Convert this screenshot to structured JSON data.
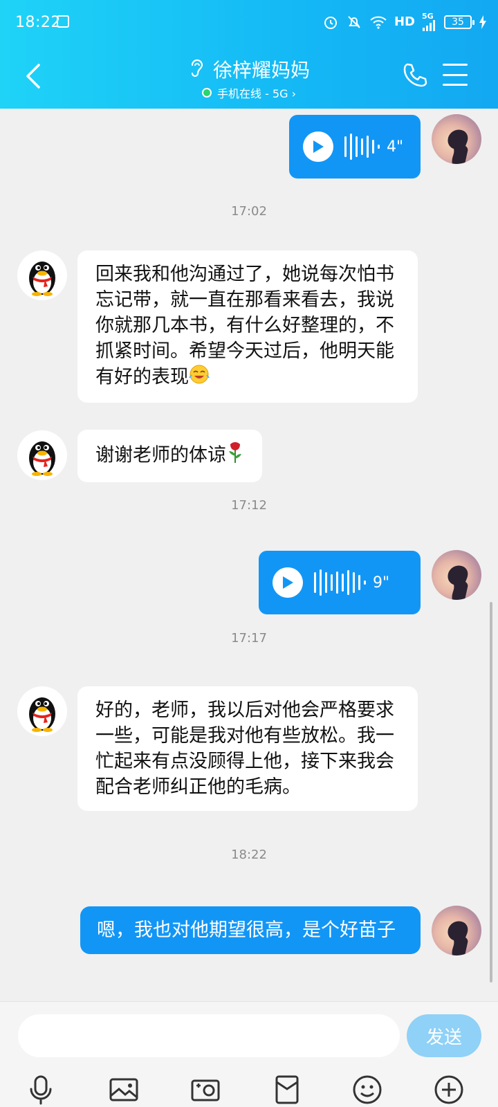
{
  "status_bar": {
    "time": "18:22",
    "network": "HD",
    "signal": "5G",
    "battery": "35"
  },
  "header": {
    "title": "徐梓耀妈妈",
    "subtitle": "手机在线 - 5G ›"
  },
  "messages": {
    "voice1_duration": "4\"",
    "time1": "17:02",
    "msg1": "回来我和他沟通过了，她说每次怕书忘记带，就一直在那看来看去，我说你就那几本书，有什么好整理的，不抓紧时间。希望今天过后，他明天能有好的表现",
    "msg2": "谢谢老师的体谅",
    "time2": "17:12",
    "voice2_duration": "9\"",
    "time3": "17:17",
    "msg3": "好的，老师，我以后对他会严格要求一些，可能是我对他有些放松。我一忙起来有点没顾得上他，接下来我会配合老师纠正他的毛病。",
    "time4": "18:22",
    "msg4": "嗯，我也对他期望很高，是个好苗子"
  },
  "input": {
    "placeholder": "",
    "send_label": "发送"
  },
  "icons": {
    "back": "chevron-left-icon",
    "hearing": "ear-icon",
    "call": "phone-icon",
    "menu": "hamburger-menu-icon",
    "mic": "microphone-icon",
    "image": "image-icon",
    "camera": "camera-icon",
    "redpacket": "red-packet-icon",
    "emoji": "smiley-icon",
    "more": "plus-circle-icon"
  },
  "colors": {
    "header_start": "#1fd3f7",
    "header_end": "#13a8f2",
    "outgoing_bubble": "#1296f6",
    "send_button": "#8fd1f7",
    "online": "#27d66d"
  }
}
